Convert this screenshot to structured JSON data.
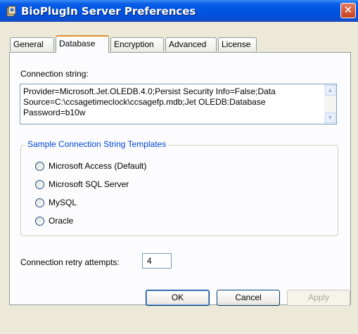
{
  "window": {
    "title": "BioPlugIn Server Preferences",
    "close_glyph": "✕"
  },
  "tabs": [
    {
      "label": "General"
    },
    {
      "label": "Database"
    },
    {
      "label": "Encryption"
    },
    {
      "label": "Advanced"
    },
    {
      "label": "License"
    }
  ],
  "active_tab": "Database",
  "database": {
    "connection_label": "Connection string:",
    "connection_string": "Provider=Microsoft.Jet.OLEDB.4.0;Persist Security Info=False;Data Source=C:\\ccsagetimeclock\\ccsagefp.mdb;Jet OLEDB:Database Password=b10w",
    "templates_legend": "Sample Connection String Templates",
    "templates": [
      {
        "label": "Microsoft Access (Default)",
        "selected": false
      },
      {
        "label": "Microsoft SQL Server",
        "selected": false
      },
      {
        "label": "MySQL",
        "selected": false
      },
      {
        "label": "Oracle",
        "selected": false
      }
    ],
    "retry_label": "Connection retry attempts:",
    "retry_value": "4"
  },
  "buttons": {
    "ok": "OK",
    "cancel": "Cancel",
    "apply": "Apply"
  },
  "colors": {
    "titlebar": "#0054e3",
    "active_tab_accent": "#e68b2c",
    "group_legend": "#0046d5",
    "close_button": "#c8401d"
  },
  "icons": {
    "app": "app-icon",
    "scroll_up": "scroll-up-arrow-icon",
    "scroll_down": "scroll-down-arrow-icon"
  }
}
